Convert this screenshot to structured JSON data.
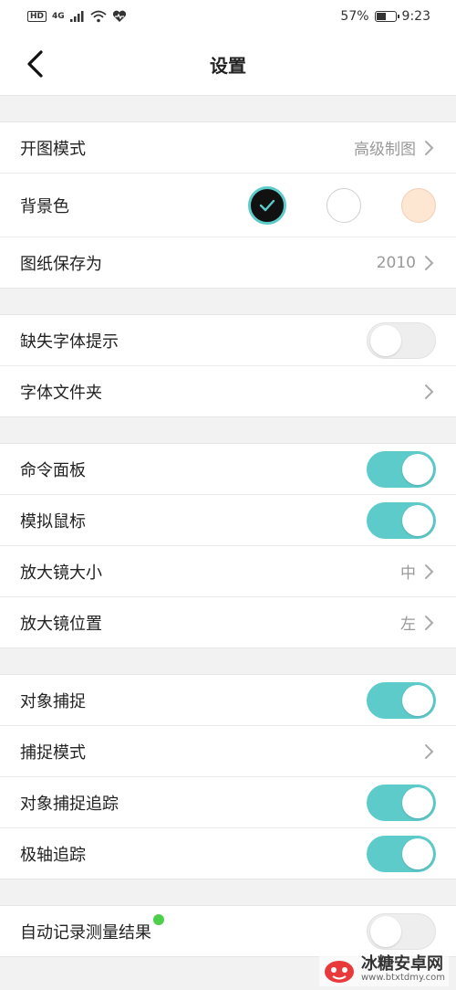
{
  "statusbar": {
    "hd": "HD",
    "network": "4G",
    "battery_text": "57%",
    "battery_level": 0.57,
    "time": "9:23"
  },
  "header": {
    "title": "设置"
  },
  "groups": [
    {
      "rows": [
        {
          "label": "开图模式",
          "value": "高级制图"
        },
        {
          "label": "背景色"
        },
        {
          "label": "图纸保存为",
          "value": "2010"
        }
      ]
    },
    {
      "rows": [
        {
          "label": "缺失字体提示",
          "toggle": false
        },
        {
          "label": "字体文件夹"
        }
      ]
    },
    {
      "rows": [
        {
          "label": "命令面板",
          "toggle": true
        },
        {
          "label": "模拟鼠标",
          "toggle": true
        },
        {
          "label": "放大镜大小",
          "value": "中"
        },
        {
          "label": "放大镜位置",
          "value": "左"
        }
      ]
    },
    {
      "rows": [
        {
          "label": "对象捕捉",
          "toggle": true
        },
        {
          "label": "捕捉模式"
        },
        {
          "label": "对象捕捉追踪",
          "toggle": true
        },
        {
          "label": "极轴追踪",
          "toggle": true
        }
      ]
    },
    {
      "rows": [
        {
          "label": "自动记录测量结果",
          "toggle": false
        }
      ]
    }
  ],
  "colors": {
    "accent": "#5ecbcb",
    "bg_black": "#111111",
    "bg_white": "#ffffff",
    "bg_peach": "#fde6d2"
  },
  "watermark": {
    "main": "冰糖安卓网",
    "url": "www.btxtdmy.com"
  }
}
